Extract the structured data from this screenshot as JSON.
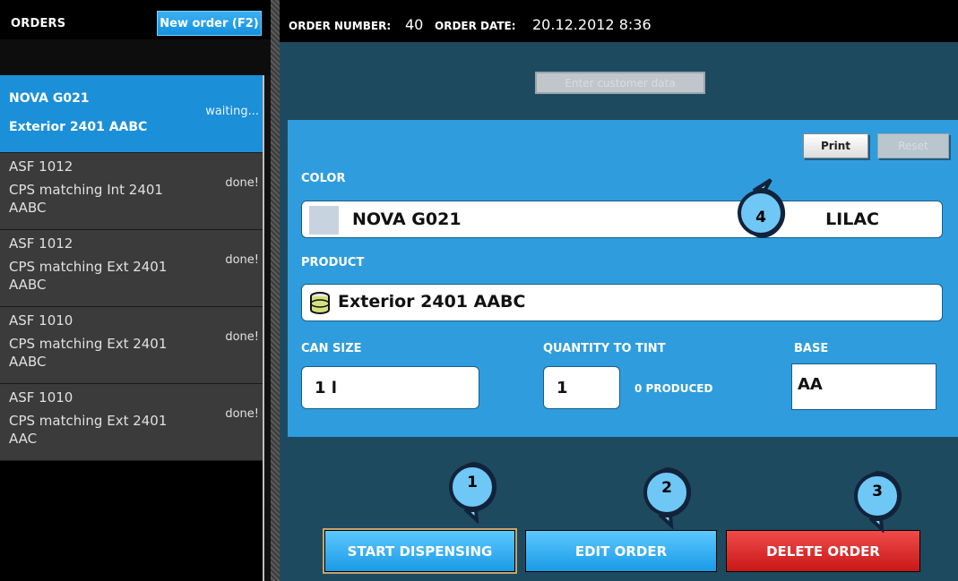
{
  "sidebar": {
    "title": "ORDERS",
    "new_order_label": "New order (F2)",
    "orders": [
      {
        "line1": "NOVA G021",
        "line2": "Exterior 2401 AABC",
        "status": "waiting..."
      },
      {
        "line1": "ASF 1012",
        "line2": "CPS matching Int 2401 AABC",
        "status": "done!"
      },
      {
        "line1": "ASF 1012",
        "line2": "CPS matching Ext 2401 AABC",
        "status": "done!"
      },
      {
        "line1": "ASF 1010",
        "line2": "CPS matching Ext 2401 AABC",
        "status": "done!"
      },
      {
        "line1": "ASF 1010",
        "line2": "CPS matching Ext 2401 AAC",
        "status": "done!"
      }
    ]
  },
  "header": {
    "order_number_label": "ORDER NUMBER:",
    "order_number": "40",
    "order_date_label": "ORDER DATE:",
    "order_date": "20.12.2012 8:36"
  },
  "customer_button_label": "Enter customer data",
  "form": {
    "print_label": "Print",
    "reset_label": "Reset",
    "color_label": "COLOR",
    "color_code": "NOVA G021",
    "color_name": "LILAC",
    "color_swatch": "#c7d4df",
    "product_label": "PRODUCT",
    "product_name": "Exterior 2401 AABC",
    "product_icon": "can-icon",
    "can_size_label": "CAN SIZE",
    "can_size": "1 l",
    "quantity_label": "QUANTITY TO TINT",
    "quantity": "1",
    "produced": "0 PRODUCED",
    "base_label": "BASE",
    "base": "AA"
  },
  "actions": {
    "start_label": "START DISPENSING",
    "edit_label": "EDIT ORDER",
    "delete_label": "DELETE ORDER"
  },
  "callouts": [
    "1",
    "2",
    "3",
    "4"
  ],
  "colors": {
    "accent_blue": "#2f9ddd",
    "delete_red": "#d42020",
    "main_bg": "#1e4a60"
  }
}
